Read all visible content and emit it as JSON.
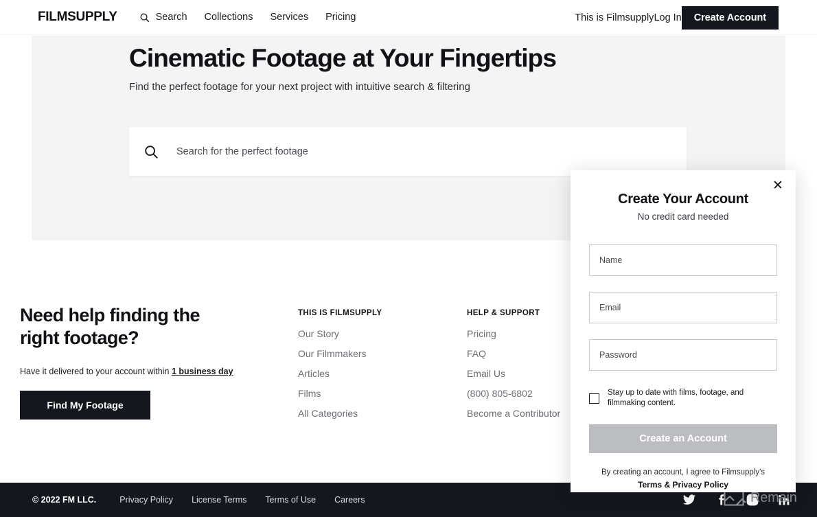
{
  "header": {
    "brand": "FILMSUPPLY",
    "search_icon": "search-icon",
    "nav": [
      {
        "label": "Search"
      },
      {
        "label": "Collections"
      },
      {
        "label": "Services"
      },
      {
        "label": "Pricing"
      }
    ],
    "this_is_filmsupply": "This is Filmsupply",
    "log_in": "Log In",
    "create_account": "Create Account"
  },
  "hero": {
    "title": "Cinematic Footage at Your Fingertips",
    "subtitle": "Find the perfect footage for your next project with intuitive search & filtering",
    "search": {
      "icon": "search-icon",
      "placeholder": "Search for the perfect footage",
      "value": ""
    }
  },
  "help": {
    "title_line1": "Need help finding the",
    "title_line2": "right footage?",
    "note_prefix": "Have it delivered to your account within ",
    "note_emphasis": "1 business day",
    "button": "Find My Footage"
  },
  "footer_columns": [
    {
      "heading": "THIS IS FILMSUPPLY",
      "links": [
        "Our Story",
        "Our Filmmakers",
        "Articles",
        "Films",
        "All Categories"
      ]
    },
    {
      "heading": "HELP & SUPPORT",
      "links": [
        "Pricing",
        "FAQ",
        "Email Us",
        "(800) 805-6802",
        "Become a Contributor"
      ]
    }
  ],
  "bottombar": {
    "copyright": "© 2022 FM LLC.",
    "links": [
      "Privacy Policy",
      "License Terms",
      "Terms of Use",
      "Careers"
    ],
    "socials": [
      "twitter-icon",
      "facebook-icon",
      "instagram-icon",
      "linkedin-icon"
    ],
    "broken_image_label": "Remain"
  },
  "modal": {
    "close_icon": "✕",
    "title": "Create Your Account",
    "subtitle": "No credit card needed",
    "fields": [
      {
        "name": "name-field",
        "label": "Name",
        "value": ""
      },
      {
        "name": "email-field",
        "label": "Email",
        "value": ""
      },
      {
        "name": "password-field",
        "label": "Password",
        "value": ""
      }
    ],
    "checkbox_label": "Stay up to date with films, footage, and filmmaking content.",
    "checkbox_checked": false,
    "submit_label": "Create an Account",
    "tos_text": "By creating an account, I agree to Filmsupply's",
    "tos_link": "Terms & Privacy Policy"
  },
  "colors": {
    "dark": "#15171e",
    "hero_bg": "#f4f4f4",
    "muted_link": "#6d6f75",
    "disabled_button": "#bcbdc0"
  }
}
